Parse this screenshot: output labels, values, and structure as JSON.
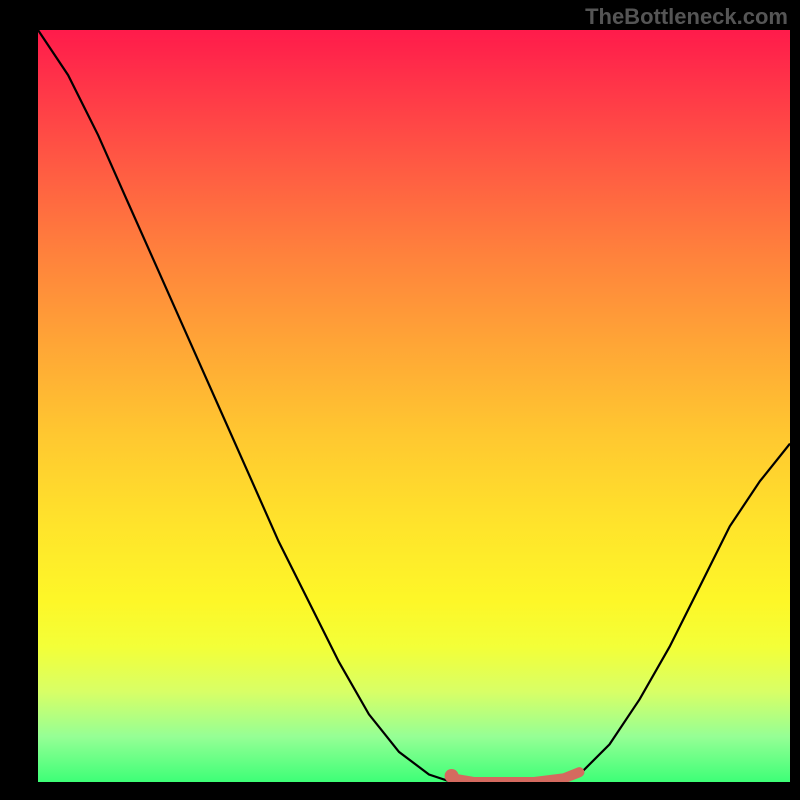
{
  "watermark": "TheBottleneck.com",
  "chart_data": {
    "type": "line",
    "title": "",
    "xlabel": "",
    "ylabel": "",
    "x_range": [
      0,
      100
    ],
    "y_range": [
      0,
      100
    ],
    "series": [
      {
        "name": "curve",
        "color": "#000000",
        "x": [
          0,
          4,
          8,
          12,
          16,
          20,
          24,
          28,
          32,
          36,
          40,
          44,
          48,
          52,
          55,
          58,
          62,
          66,
          70,
          72,
          76,
          80,
          84,
          88,
          92,
          96,
          100
        ],
        "y": [
          100,
          94,
          86,
          77,
          68,
          59,
          50,
          41,
          32,
          24,
          16,
          9,
          4,
          1,
          0,
          0,
          0,
          0,
          0,
          1,
          5,
          11,
          18,
          26,
          34,
          40,
          45
        ]
      },
      {
        "name": "highlight",
        "color": "#d46a5f",
        "x": [
          55,
          58,
          62,
          66,
          70,
          72
        ],
        "y": [
          0.5,
          0,
          0,
          0,
          0.5,
          1.3
        ]
      }
    ],
    "highlight_dot": {
      "x": 55,
      "y": 0.8,
      "color": "#d46a5f"
    }
  }
}
